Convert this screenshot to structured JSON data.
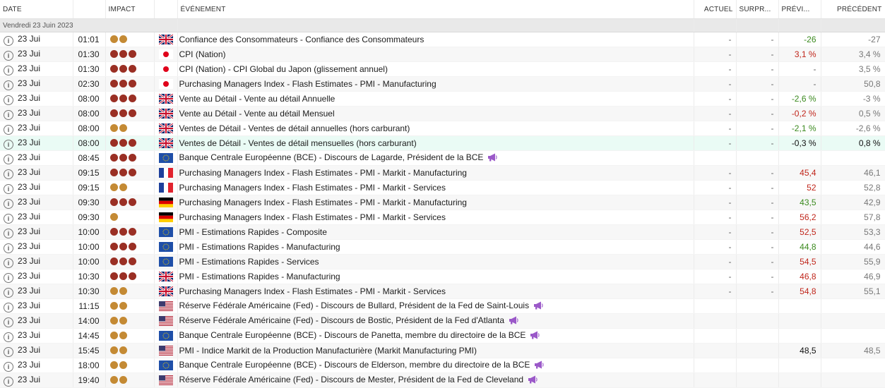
{
  "headers": {
    "date": "DATE",
    "impact": "IMPACT",
    "event": "ÉVÉNEMENT",
    "actual": "ACTUEL",
    "surprise": "SURPR...",
    "forecast": "PRÉVI...",
    "previous": "PRÉCÉDENT"
  },
  "group_label": "Vendredi 23 Juin 2023",
  "colors": {
    "high": "#9a2f24",
    "medium": "#c48a34",
    "positive": "#3b8a1f",
    "negative": "#c0261b",
    "highlight": "#eafbf5"
  },
  "rows": [
    {
      "date": "23 Jui",
      "time": "01:01",
      "impact": 2,
      "flag": "uk",
      "event": "Confiance des Consommateurs - Confiance des Consommateurs",
      "speech": false,
      "actual": "-",
      "surprise": "-",
      "forecast": "-26",
      "forecast_color": "green",
      "previous": "-27",
      "previous_color": "grey"
    },
    {
      "date": "23 Jui",
      "time": "01:30",
      "impact": 3,
      "flag": "jp",
      "event": "CPI (Nation)",
      "speech": false,
      "actual": "-",
      "surprise": "-",
      "forecast": "3,1 %",
      "forecast_color": "red",
      "previous": "3,4 %",
      "previous_color": "grey"
    },
    {
      "date": "23 Jui",
      "time": "01:30",
      "impact": 3,
      "flag": "jp",
      "event": "CPI (Nation) - CPI Global du Japon (glissement annuel)",
      "speech": false,
      "actual": "-",
      "surprise": "-",
      "forecast": "-",
      "forecast_color": "dash",
      "previous": "3,5 %",
      "previous_color": "grey"
    },
    {
      "date": "23 Jui",
      "time": "02:30",
      "impact": 3,
      "flag": "jp",
      "event": "Purchasing Managers Index - Flash Estimates - PMI - Manufacturing",
      "speech": false,
      "actual": "-",
      "surprise": "-",
      "forecast": "-",
      "forecast_color": "dash",
      "previous": "50,8",
      "previous_color": "grey"
    },
    {
      "date": "23 Jui",
      "time": "08:00",
      "impact": 3,
      "flag": "uk",
      "event": "Vente au Détail - Vente au détail Annuelle",
      "speech": false,
      "actual": "-",
      "surprise": "-",
      "forecast": "-2,6 %",
      "forecast_color": "green",
      "previous": "-3 %",
      "previous_color": "grey"
    },
    {
      "date": "23 Jui",
      "time": "08:00",
      "impact": 3,
      "flag": "uk",
      "event": "Vente au Détail - Vente au détail Mensuel",
      "speech": false,
      "actual": "-",
      "surprise": "-",
      "forecast": "-0,2 %",
      "forecast_color": "red",
      "previous": "0,5 %",
      "previous_color": "grey"
    },
    {
      "date": "23 Jui",
      "time": "08:00",
      "impact": 2,
      "flag": "uk",
      "event": "Ventes de Détail - Ventes de détail annuelles (hors carburant)",
      "speech": false,
      "actual": "-",
      "surprise": "-",
      "forecast": "-2,1 %",
      "forecast_color": "green",
      "previous": "-2,6 %",
      "previous_color": "grey"
    },
    {
      "date": "23 Jui",
      "time": "08:00",
      "impact": 3,
      "flag": "uk",
      "event": "Ventes de Détail - Ventes de détail mensuelles (hors carburant)",
      "speech": false,
      "actual": "-",
      "surprise": "-",
      "forecast": "-0,3 %",
      "forecast_color": "black",
      "previous": "0,8 %",
      "previous_color": "black",
      "highlight": true
    },
    {
      "date": "23 Jui",
      "time": "08:45",
      "impact": 3,
      "flag": "eu",
      "event": "Banque Centrale Européenne (BCE) - Discours de Lagarde, Président de la BCE",
      "speech": true,
      "actual": "",
      "surprise": "",
      "forecast": "",
      "forecast_color": "grey",
      "previous": "",
      "previous_color": "grey"
    },
    {
      "date": "23 Jui",
      "time": "09:15",
      "impact": 3,
      "flag": "fr",
      "event": "Purchasing Managers Index - Flash Estimates - PMI - Markit - Manufacturing",
      "speech": false,
      "actual": "-",
      "surprise": "-",
      "forecast": "45,4",
      "forecast_color": "red",
      "previous": "46,1",
      "previous_color": "grey"
    },
    {
      "date": "23 Jui",
      "time": "09:15",
      "impact": 2,
      "flag": "fr",
      "event": "Purchasing Managers Index - Flash Estimates - PMI - Markit - Services",
      "speech": false,
      "actual": "-",
      "surprise": "-",
      "forecast": "52",
      "forecast_color": "red",
      "previous": "52,8",
      "previous_color": "grey"
    },
    {
      "date": "23 Jui",
      "time": "09:30",
      "impact": 3,
      "flag": "de",
      "event": "Purchasing Managers Index - Flash Estimates - PMI - Markit - Manufacturing",
      "speech": false,
      "actual": "-",
      "surprise": "-",
      "forecast": "43,5",
      "forecast_color": "green",
      "previous": "42,9",
      "previous_color": "grey"
    },
    {
      "date": "23 Jui",
      "time": "09:30",
      "impact": 1,
      "flag": "de",
      "event": "Purchasing Managers Index - Flash Estimates - PMI - Markit - Services",
      "speech": false,
      "actual": "-",
      "surprise": "-",
      "forecast": "56,2",
      "forecast_color": "red",
      "previous": "57,8",
      "previous_color": "grey"
    },
    {
      "date": "23 Jui",
      "time": "10:00",
      "impact": 3,
      "flag": "eu",
      "event": "PMI - Estimations Rapides - Composite",
      "speech": false,
      "actual": "-",
      "surprise": "-",
      "forecast": "52,5",
      "forecast_color": "red",
      "previous": "53,3",
      "previous_color": "grey"
    },
    {
      "date": "23 Jui",
      "time": "10:00",
      "impact": 3,
      "flag": "eu",
      "event": "PMI - Estimations Rapides - Manufacturing",
      "speech": false,
      "actual": "-",
      "surprise": "-",
      "forecast": "44,8",
      "forecast_color": "green",
      "previous": "44,6",
      "previous_color": "grey"
    },
    {
      "date": "23 Jui",
      "time": "10:00",
      "impact": 3,
      "flag": "eu",
      "event": "PMI - Estimations Rapides - Services",
      "speech": false,
      "actual": "-",
      "surprise": "-",
      "forecast": "54,5",
      "forecast_color": "red",
      "previous": "55,9",
      "previous_color": "grey"
    },
    {
      "date": "23 Jui",
      "time": "10:30",
      "impact": 3,
      "flag": "uk",
      "event": "PMI - Estimations Rapides - Manufacturing",
      "speech": false,
      "actual": "-",
      "surprise": "-",
      "forecast": "46,8",
      "forecast_color": "red",
      "previous": "46,9",
      "previous_color": "grey"
    },
    {
      "date": "23 Jui",
      "time": "10:30",
      "impact": 2,
      "flag": "uk",
      "event": "Purchasing Managers Index - Flash Estimates - PMI - Markit - Services",
      "speech": false,
      "actual": "-",
      "surprise": "-",
      "forecast": "54,8",
      "forecast_color": "red",
      "previous": "55,1",
      "previous_color": "grey"
    },
    {
      "date": "23 Jui",
      "time": "11:15",
      "impact": 2,
      "flag": "us",
      "event": "Réserve Fédérale Américaine (Fed) - Discours de Bullard, Président de la Fed de Saint-Louis",
      "speech": true,
      "actual": "",
      "surprise": "",
      "forecast": "",
      "forecast_color": "grey",
      "previous": "",
      "previous_color": "grey"
    },
    {
      "date": "23 Jui",
      "time": "14:00",
      "impact": 2,
      "flag": "us",
      "event": "Réserve Fédérale Américaine (Fed) - Discours de Bostic, Président de la Fed d'Atlanta",
      "speech": true,
      "actual": "",
      "surprise": "",
      "forecast": "",
      "forecast_color": "grey",
      "previous": "",
      "previous_color": "grey"
    },
    {
      "date": "23 Jui",
      "time": "14:45",
      "impact": 2,
      "flag": "eu",
      "event": "Banque Centrale Européenne (BCE) - Discours de Panetta, membre du directoire de la BCE",
      "speech": true,
      "actual": "",
      "surprise": "",
      "forecast": "",
      "forecast_color": "grey",
      "previous": "",
      "previous_color": "grey"
    },
    {
      "date": "23 Jui",
      "time": "15:45",
      "impact": 2,
      "flag": "us",
      "event": "PMI - Indice Markit de la Production Manufacturière (Markit Manufacturing PMI)",
      "speech": false,
      "actual": "",
      "surprise": "",
      "forecast": "48,5",
      "forecast_color": "black",
      "previous": "48,5",
      "previous_color": "grey"
    },
    {
      "date": "23 Jui",
      "time": "18:00",
      "impact": 2,
      "flag": "eu",
      "event": "Banque Centrale Européenne (BCE) - Discours de Elderson, membre du directoire de la BCE",
      "speech": true,
      "actual": "",
      "surprise": "",
      "forecast": "",
      "forecast_color": "grey",
      "previous": "",
      "previous_color": "grey"
    },
    {
      "date": "23 Jui",
      "time": "19:40",
      "impact": 2,
      "flag": "us",
      "event": "Réserve Fédérale Américaine (Fed) - Discours de Mester, Président de la Fed de Cleveland",
      "speech": true,
      "actual": "",
      "surprise": "",
      "forecast": "",
      "forecast_color": "grey",
      "previous": "",
      "previous_color": "grey"
    }
  ]
}
